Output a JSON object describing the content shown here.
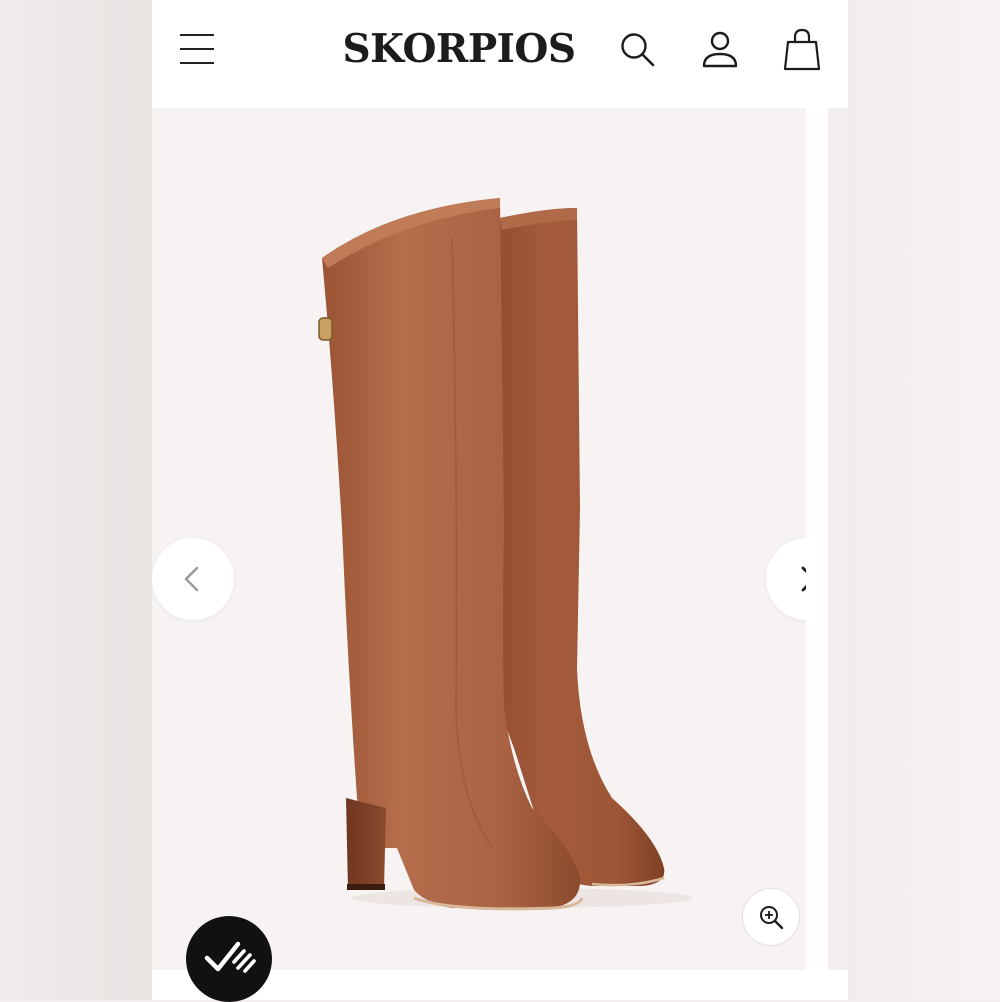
{
  "header": {
    "brand_logo": "SKORPIOS",
    "icons": [
      "menu-icon",
      "search-icon",
      "account-icon",
      "shopping-bag-icon"
    ]
  },
  "product_gallery": {
    "product_image": "brown-leather-knee-high-boots",
    "controls": [
      "chevron-left-icon",
      "chevron-right-icon",
      "zoom-in-icon"
    ]
  },
  "overlay_badge": {
    "icon": "checkmark-badge-icon"
  },
  "colors": {
    "boot_leather": "#a8603f",
    "hero_background": "#f7f3f3",
    "text_primary": "#1c1c1c"
  }
}
